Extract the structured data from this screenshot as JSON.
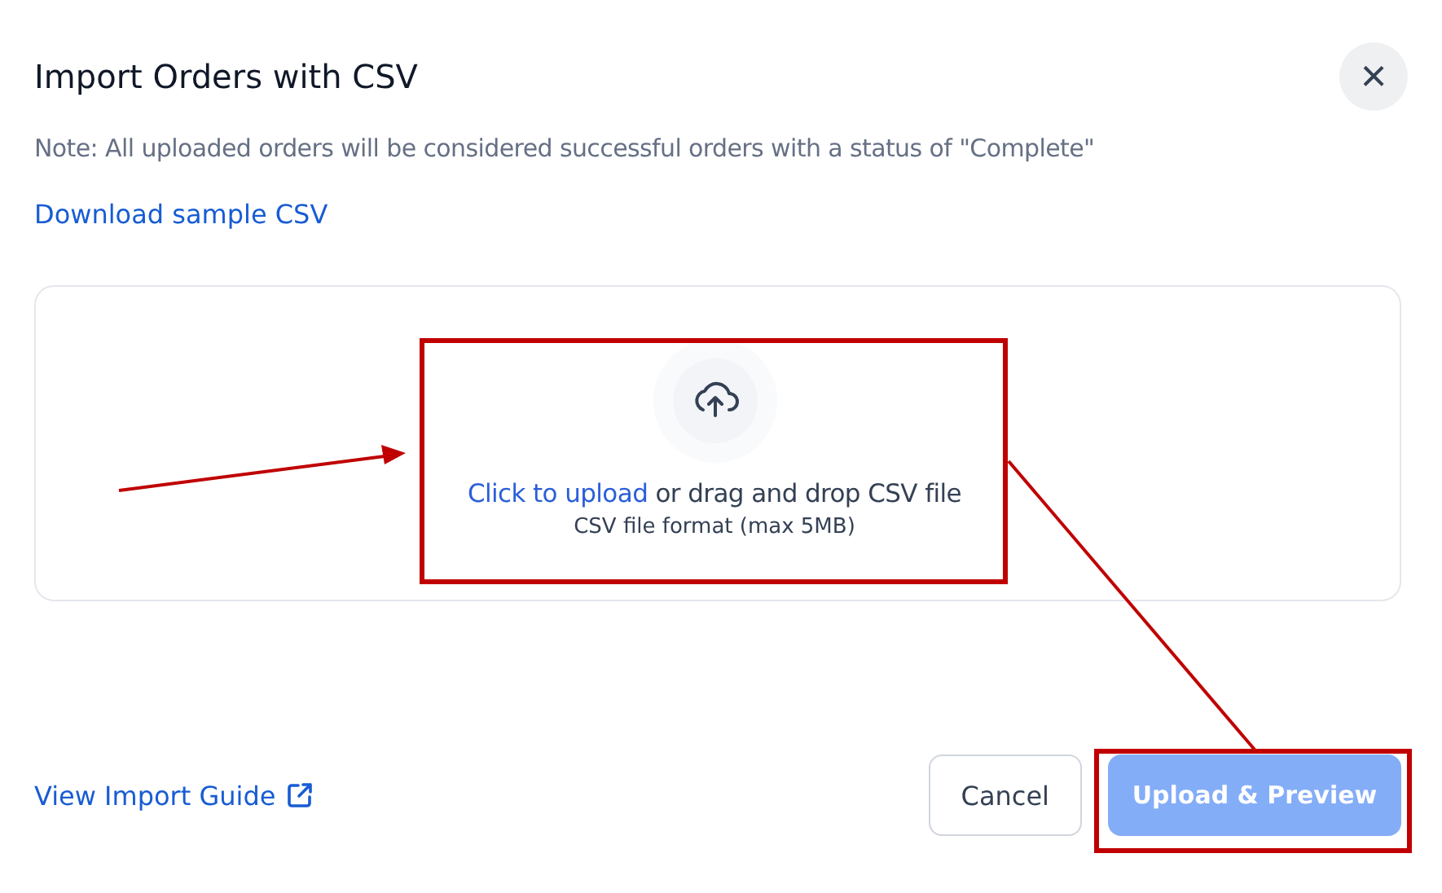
{
  "dialog": {
    "title": "Import Orders with CSV",
    "close": {
      "label": "×"
    },
    "note": "Note: All uploaded orders will be considered successful orders with a status of \"Complete\"",
    "sample_link": "Download sample CSV",
    "dropzone": {
      "upload_link": "Click to upload",
      "instruction": "or drag and drop CSV file",
      "hint": "CSV file format (max 5MB)"
    },
    "guide_link": "View Import Guide",
    "buttons": [
      {
        "label": "Cancel",
        "kind": "secondary",
        "disabled": false
      },
      {
        "label": "Upload & Preview",
        "kind": "primary",
        "disabled": true
      }
    ]
  },
  "annotations": [
    {
      "kind": "box"
    },
    {
      "kind": "box"
    },
    {
      "kind": "arrow"
    },
    {
      "kind": "line"
    }
  ]
}
